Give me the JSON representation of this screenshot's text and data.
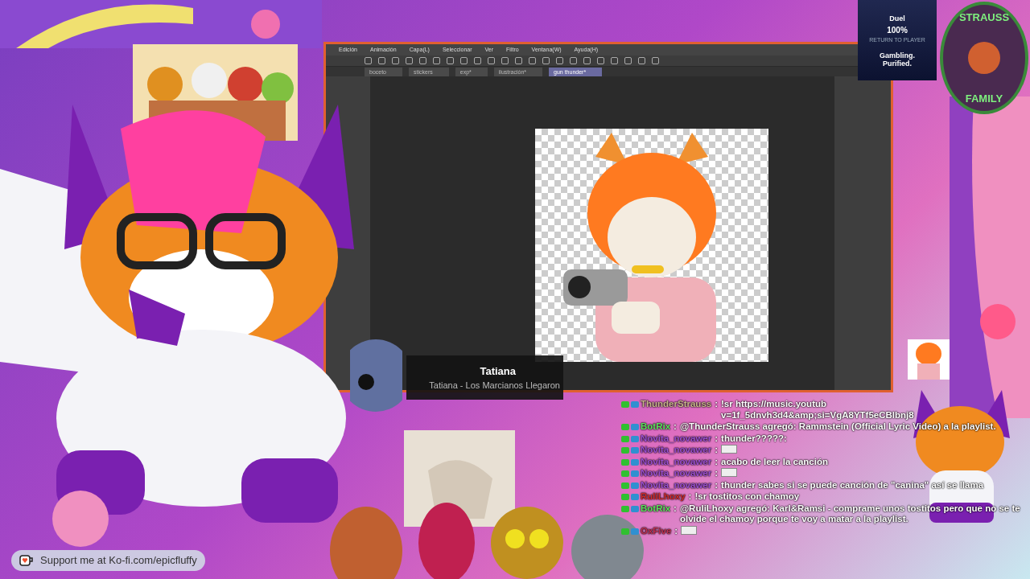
{
  "app": {
    "menu": [
      "Edición",
      "Animación",
      "Capa(L)",
      "Seleccionar",
      "Ver",
      "Filtro",
      "Ventana(W)",
      "Ayuda(H)"
    ],
    "tabs": [
      {
        "label": "boceto",
        "selected": false
      },
      {
        "label": "stickers",
        "selected": false
      },
      {
        "label": "exp*",
        "selected": false
      },
      {
        "label": "ilustración*",
        "selected": false
      },
      {
        "label": "gun thunder*",
        "selected": true
      }
    ]
  },
  "ad": {
    "title": "Duel",
    "value": "100%",
    "caption": "RETURN TO PLAYER",
    "tagline": "Gambling. Purified."
  },
  "logo": {
    "top": "STRAUSS",
    "bottom": "FAMILY"
  },
  "now_playing": {
    "title": "Tatiana",
    "subtitle": "Tatiana - Los Marcianos Llegaron"
  },
  "chat": [
    {
      "user": "ThunderStrauss",
      "color": "#c8b48a",
      "kind": "text",
      "text": "!sr https://music.youtub v=1f_5dnvh3d4&amp;si=VgA8YTf5eCBlbnj8"
    },
    {
      "user": "BotRix",
      "color": "#5ee05e",
      "kind": "text",
      "text": "@ThunderStrauss agregó: Rammstein (Official Lyric Video) a la playlist."
    },
    {
      "user": "Novita_novawer",
      "color": "#9a4fd0",
      "kind": "text",
      "text": "thunder?????:"
    },
    {
      "user": "Novita_novawer",
      "color": "#9a4fd0",
      "kind": "emote"
    },
    {
      "user": "Novita_novawer",
      "color": "#9a4fd0",
      "kind": "text",
      "text": "acabo de leer la canción"
    },
    {
      "user": "Novita_novawer",
      "color": "#9a4fd0",
      "kind": "emote"
    },
    {
      "user": "Novita_novawer",
      "color": "#9a4fd0",
      "kind": "text",
      "text": "thunder sabes si se puede canción de \"canina\" así se llama"
    },
    {
      "user": "RuliLhoxy",
      "color": "#d02c2c",
      "kind": "text",
      "text": "!sr tostitos con chamoy"
    },
    {
      "user": "BotRix",
      "color": "#5ee05e",
      "kind": "text",
      "text": "@RuliLhoxy agregó: Karl&Ramsi - comprame unos tostitos pero que no se te olvide el chamoy porque te voy a matar a la playlist."
    },
    {
      "user": "OxFive",
      "color": "#c03050",
      "kind": "emote"
    }
  ],
  "chat_separator": ":",
  "footer": {
    "text": "Support me at Ko-fi.com/epicfluffy"
  }
}
